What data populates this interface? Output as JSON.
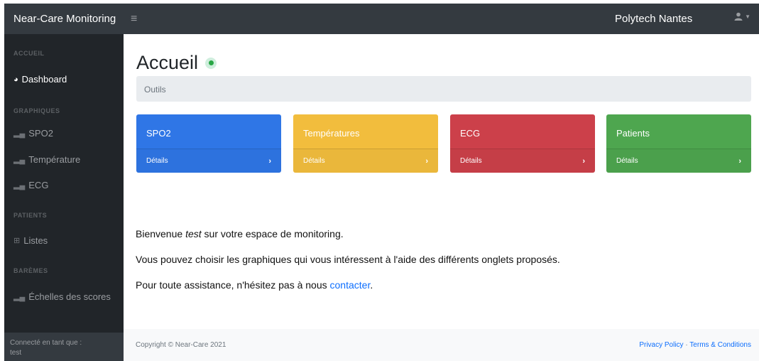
{
  "navbar": {
    "brand": "Near-Care Monitoring",
    "toggle_icon": "hamburger-icon",
    "organization": "Polytech Nantes",
    "user_icon": "user-icon"
  },
  "sidebar": {
    "sections": [
      {
        "heading": "ACCUEIL"
      },
      {
        "heading": "GRAPHIQUES"
      },
      {
        "heading": "PATIENTS"
      },
      {
        "heading": "BARÈMES"
      }
    ],
    "items": [
      {
        "label": "Dashboard",
        "icon": "dashboard-icon",
        "active": true
      },
      {
        "label": "SPO2",
        "icon": "chart-icon"
      },
      {
        "label": "Température",
        "icon": "chart-icon"
      },
      {
        "label": "ECG",
        "icon": "chart-icon"
      },
      {
        "label": "Listes",
        "icon": "table-icon"
      },
      {
        "label": "Échelles des scores",
        "icon": "chart-icon"
      }
    ],
    "footer": {
      "label": "Connecté en tant que :",
      "user": "test"
    }
  },
  "main": {
    "title": "Accueil",
    "breadcrumb": "Outils",
    "cards": [
      {
        "title": "SPO2",
        "link": "Détails",
        "color": "#2f76e6"
      },
      {
        "title": "Températures",
        "link": "Détails",
        "color": "#f2bd3d"
      },
      {
        "title": "ECG",
        "link": "Détails",
        "color": "#cc404a"
      },
      {
        "title": "Patients",
        "link": "Détails",
        "color": "#4ea64f"
      }
    ],
    "welcome": {
      "before": "Bienvenue ",
      "user": "test",
      "after": " sur votre espace de monitoring."
    },
    "line2": "Vous pouvez choisir les graphiques qui vous intéressent à l'aide des différents onglets proposés.",
    "line3": {
      "text": "Pour toute assistance, n'hésitez pas à nous ",
      "link": "contacter",
      "end": "."
    }
  },
  "footer": {
    "copyright": "Copyright © Near-Care 2021",
    "privacy": "Privacy Policy",
    "separator": "·",
    "terms": "Terms & Conditions"
  }
}
